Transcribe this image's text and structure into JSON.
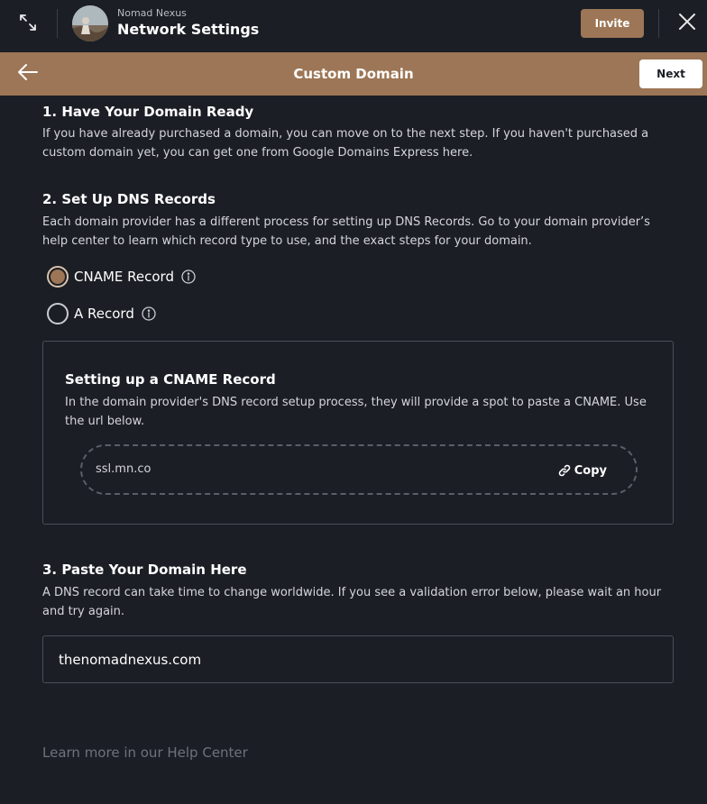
{
  "topbar": {
    "network_name": "Nomad Nexus",
    "page_title": "Network Settings",
    "invite_label": "Invite",
    "icons": {
      "expand": "expand-icon",
      "close": "close-icon",
      "avatar": "network-avatar"
    }
  },
  "header": {
    "title": "Custom Domain",
    "next_label": "Next",
    "icons": {
      "back": "arrow-left-icon"
    },
    "color": "#9c7656"
  },
  "steps": {
    "step1": {
      "title": "1. Have Your Domain Ready",
      "text": "If you have already purchased a domain, you can move on to the next step. If you haven't purchased a custom domain yet, you can get one from Google Domains Express here."
    },
    "step2": {
      "title": "2. Set Up DNS Records",
      "text": "Each domain provider has a different process for setting up DNS Records. Go to your domain provider’s help center to learn which record type to use, and the exact steps for your domain.",
      "options": [
        {
          "label": "CNAME Record",
          "selected": true
        },
        {
          "label": "A Record",
          "selected": false
        }
      ]
    },
    "cname": {
      "title": "Setting up a CNAME Record",
      "text": "In the domain provider's DNS record setup process, they will provide a spot to paste a CNAME. Use the url below.",
      "url": "ssl.mn.co",
      "copy_label": "Copy"
    },
    "step3": {
      "title": "3. Paste Your Domain Here",
      "text": "A DNS record can take time to change worldwide. If you see a validation error below, please wait an hour and try again.",
      "domain_value": "thenomadnexus.com"
    }
  },
  "footer": {
    "help_link": "Learn more in our Help Center"
  }
}
